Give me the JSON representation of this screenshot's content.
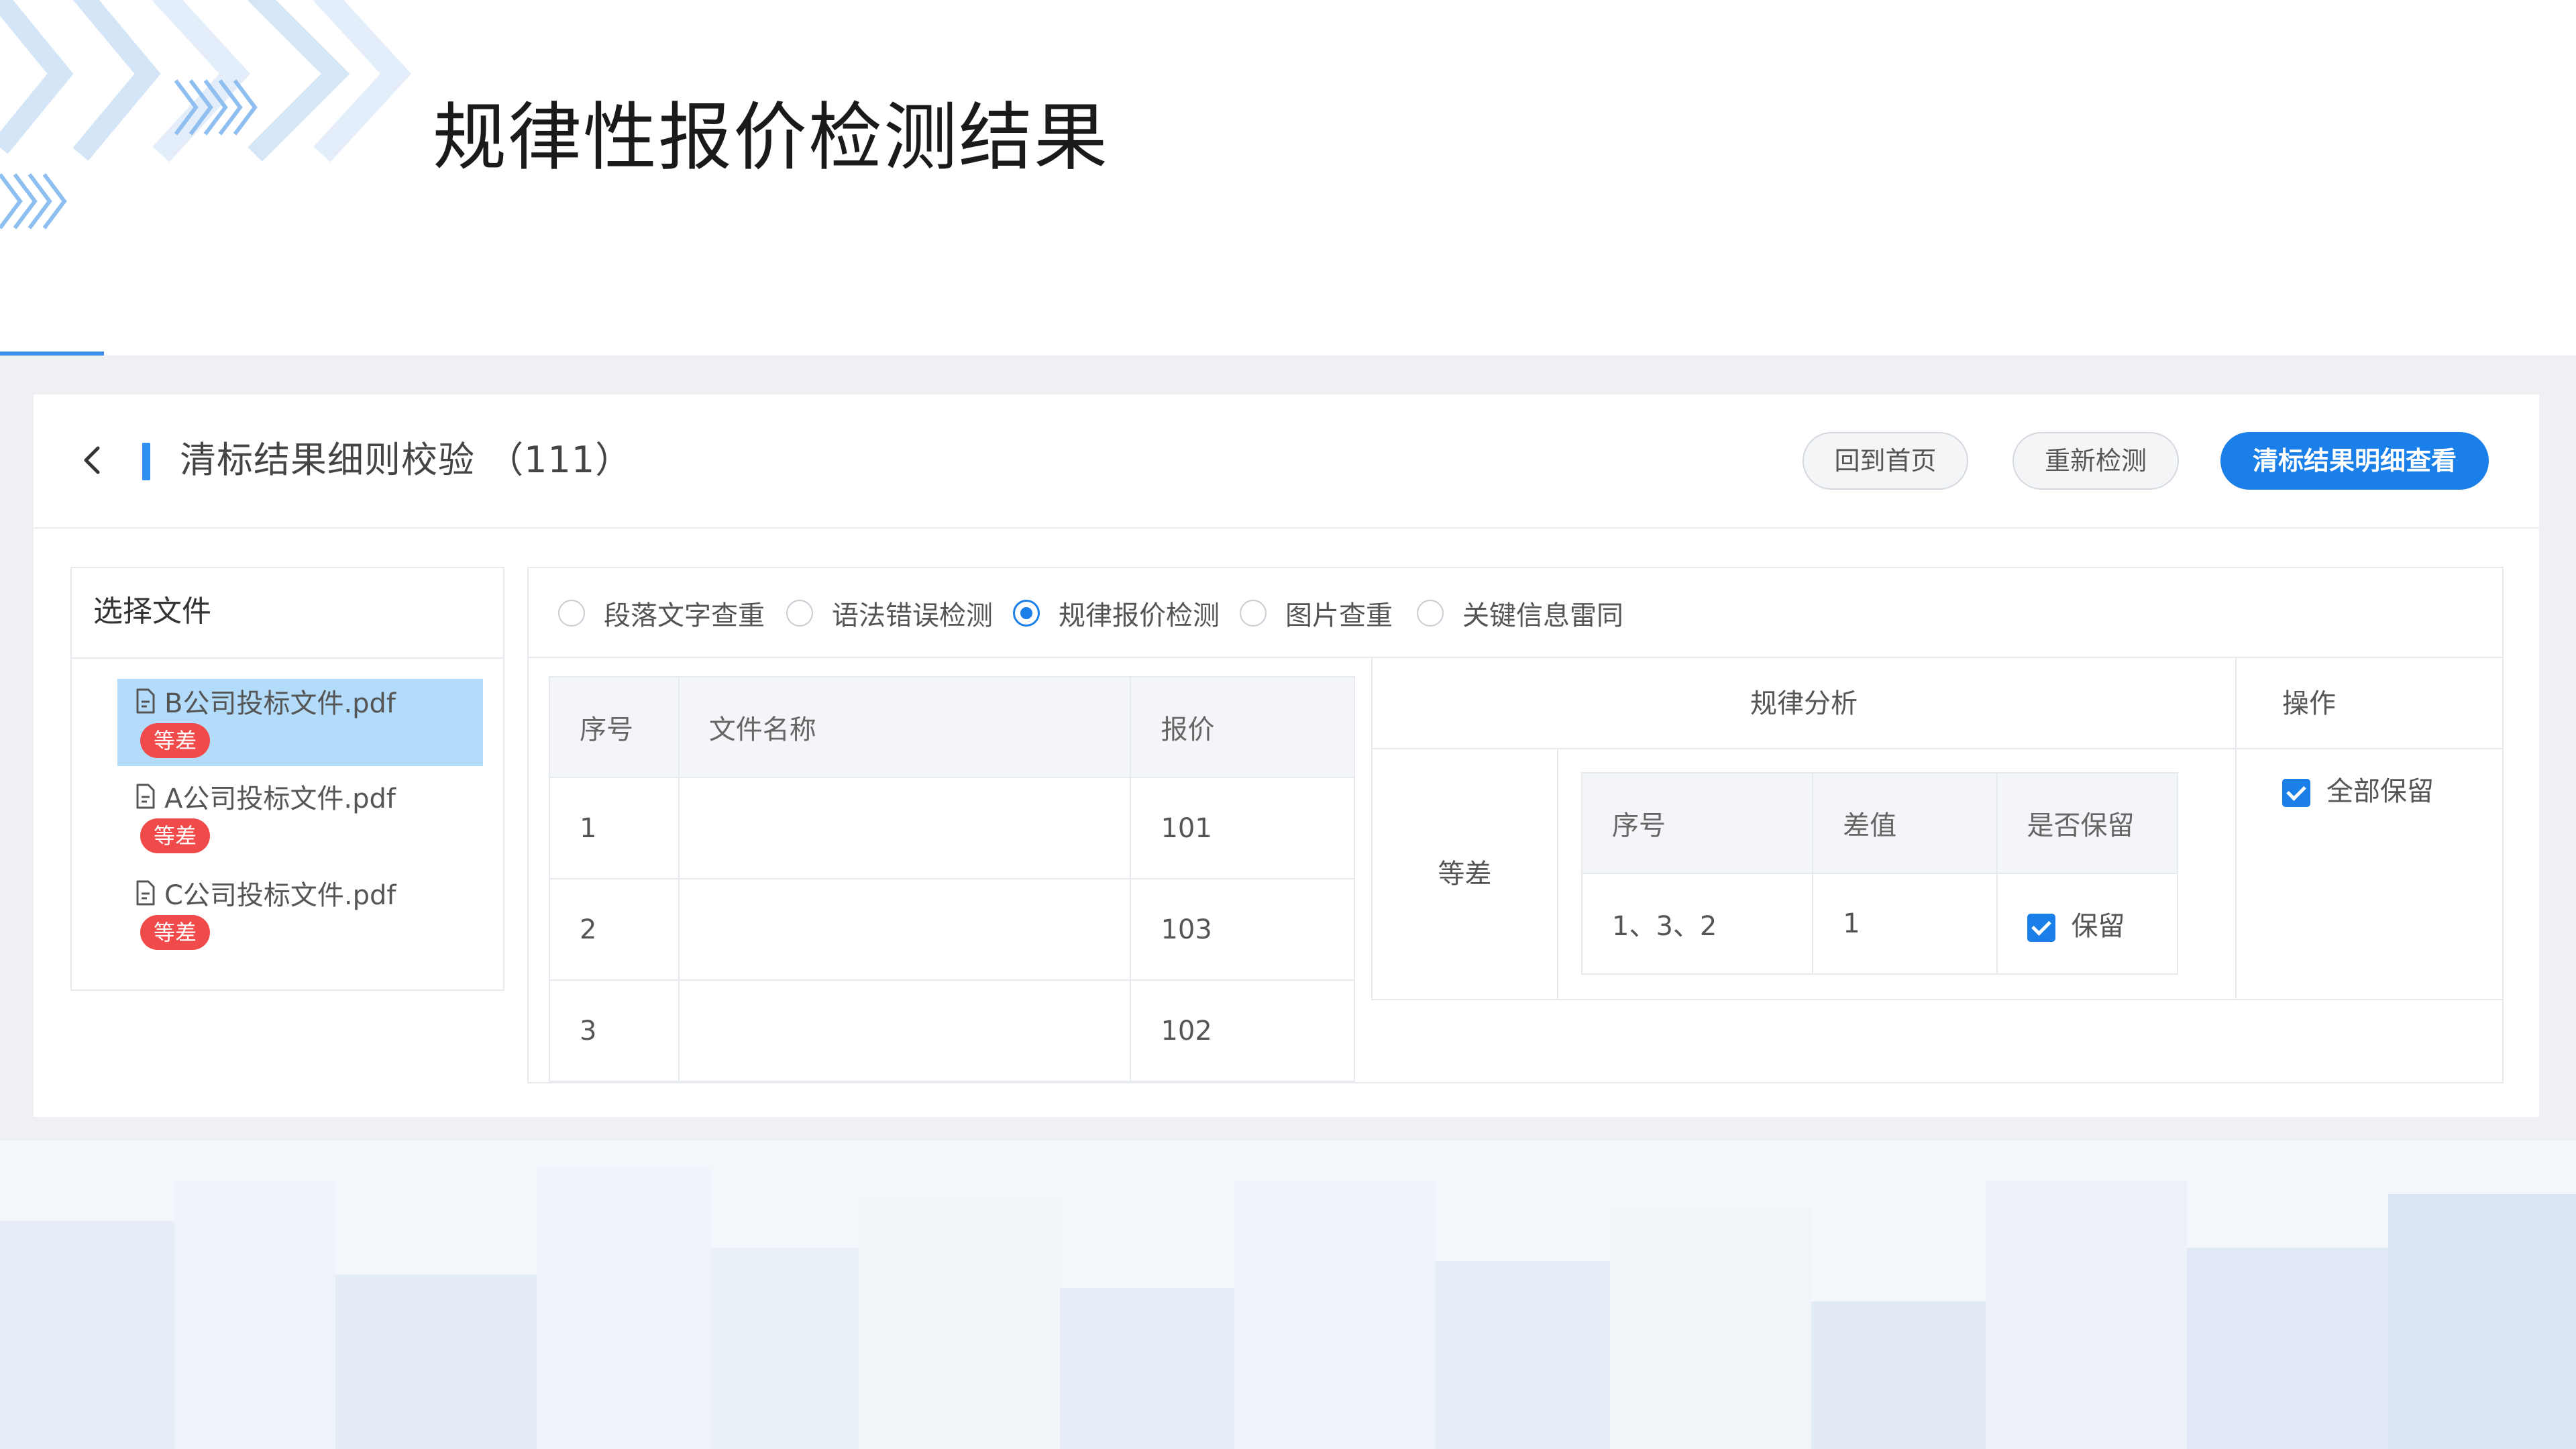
{
  "slide": {
    "title": "规律性报价检测结果"
  },
  "header": {
    "title": "清标结果细则校验 （111）",
    "buttons": {
      "home": "回到首页",
      "redetect": "重新检测",
      "detail": "清标结果明细查看"
    }
  },
  "file_panel": {
    "title": "选择文件",
    "files": [
      {
        "name": "B公司投标文件.pdf",
        "tag": "等差",
        "selected": true
      },
      {
        "name": "A公司投标文件.pdf",
        "tag": "等差",
        "selected": false
      },
      {
        "name": "C公司投标文件.pdf",
        "tag": "等差",
        "selected": false
      }
    ]
  },
  "detect_types": [
    {
      "label": "段落文字查重",
      "checked": false
    },
    {
      "label": "语法错误检测",
      "checked": false
    },
    {
      "label": "规律报价检测",
      "checked": true
    },
    {
      "label": "图片查重",
      "checked": false
    },
    {
      "label": "关键信息雷同",
      "checked": false
    }
  ],
  "price_table": {
    "headers": [
      "序号",
      "文件名称",
      "报价"
    ],
    "rows": [
      [
        "1",
        "",
        "101"
      ],
      [
        "2",
        "",
        "103"
      ],
      [
        "3",
        "",
        "102"
      ]
    ]
  },
  "analysis": {
    "title": "规律分析",
    "operation_title": "操作",
    "type": "等差",
    "inner_headers": [
      "序号",
      "差值",
      "是否保留"
    ],
    "inner_row": {
      "sequence": "1、3、2",
      "difference": "1",
      "keep_label": "保留",
      "keep_checked": true
    },
    "keep_all_label": "全部保留",
    "keep_all_checked": true
  },
  "colors": {
    "primary": "#1a7fe8",
    "tag": "#f04a4a",
    "selected_row": "#b3dcfb"
  }
}
